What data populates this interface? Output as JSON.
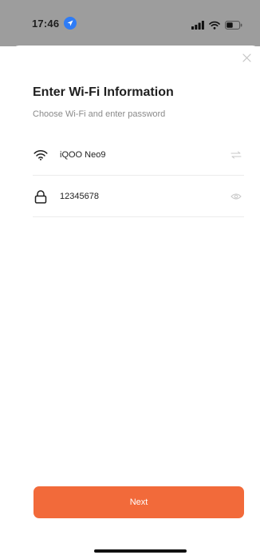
{
  "status_bar": {
    "time": "17:46",
    "location_icon": "location-arrow-icon",
    "signal_icon": "cellular-signal-icon",
    "wifi_icon": "wifi-icon",
    "battery_icon": "battery-icon"
  },
  "sheet": {
    "close_icon": "close-icon",
    "title": "Enter Wi-Fi Information",
    "subtitle": "Choose Wi-Fi and enter password",
    "wifi_field": {
      "icon": "wifi-icon",
      "value": "iQOO Neo9",
      "action_icon": "switch-network-icon"
    },
    "password_field": {
      "icon": "lock-icon",
      "value": "12345678",
      "action_icon": "eye-icon"
    },
    "next_button": "Next"
  },
  "colors": {
    "accent": "#f26a3a",
    "backdrop": "#9d9d9d",
    "location": "#2e7cf6"
  }
}
